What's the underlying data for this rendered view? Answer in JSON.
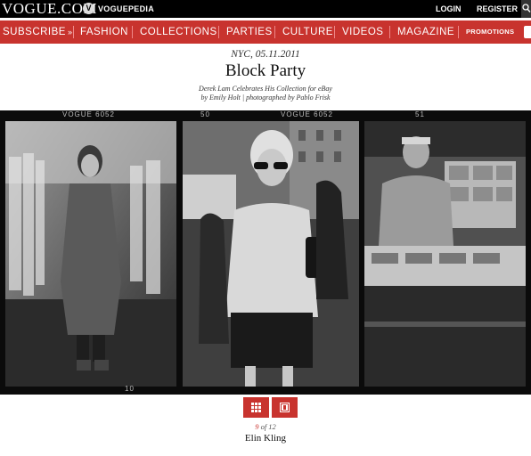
{
  "header": {
    "logo": "VOGUE.COM",
    "vp_icon": "V",
    "voguepedia": "VOGUEPEDIA",
    "login": "LOGIN",
    "register": "REGISTER"
  },
  "nav": {
    "subscribe": "SUBSCRIBE",
    "subscribe_chevron": "»",
    "items": [
      "FASHION",
      "COLLECTIONS",
      "PARTIES",
      "CULTURE",
      "VIDEOS",
      "MAGAZINE"
    ],
    "promotions": "PROMOTIONS"
  },
  "article": {
    "dateline": "NYC, 05.11.2011",
    "title": "Block Party",
    "dek_line1": "Derek Lam Celebrates His Collection for eBay",
    "dek_line2": "by Emily Holt | photographed by Pablo Frisk"
  },
  "contact_sheet": {
    "strip_label": "VOGUE 6052",
    "frame_numbers": [
      "50",
      "51"
    ],
    "bottom_number": "10"
  },
  "gallery": {
    "current": "9",
    "of_label": " of 12",
    "caption": "Elin Kling"
  },
  "colors": {
    "brand_red": "#c8332e",
    "top_bar": "#000000"
  },
  "icons": [
    "search-icon",
    "grid-view-icon",
    "single-view-icon"
  ]
}
